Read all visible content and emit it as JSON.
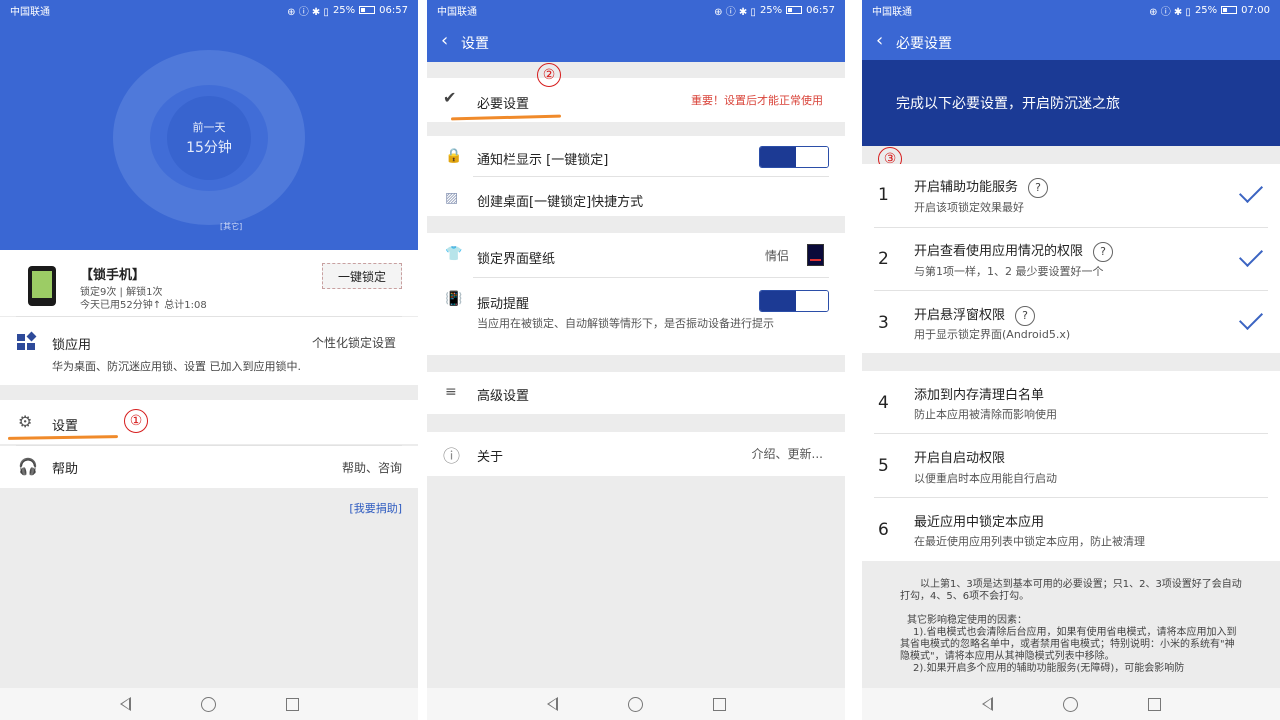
{
  "status1": {
    "carrier": "中国联通",
    "icons": "⊕ ⓘ ✱ ▯",
    "battery": "25%",
    "time": "06:57"
  },
  "status2": {
    "carrier": "中国联通",
    "icons": "⊕ ⓘ ✱ ▯",
    "battery": "25%",
    "time": "06:57"
  },
  "status3": {
    "carrier": "中国联通",
    "icons": "⊕ ⓘ ✱ ▯",
    "battery": "25%",
    "time": "07:00"
  },
  "screen1": {
    "gauge": {
      "label": "前一天",
      "value": "15分钟"
    },
    "other_tag": "[其它]",
    "lock_card": {
      "title": "【锁手机】",
      "stats1": "锁定9次 | 解锁1次",
      "stats2": "今天已用52分钟↑  总计1:08",
      "button": "一键锁定"
    },
    "lock_apps": {
      "title": "锁应用",
      "right": "个性化锁定设置",
      "subtitle": "华为桌面、防沉迷应用锁、设置 已加入到应用锁中."
    },
    "settings": {
      "title": "设置",
      "icon": "gear-icon"
    },
    "help": {
      "title": "帮助",
      "right": "帮助、咨询",
      "icon": "headset-icon"
    },
    "donate": "[我要捐助]",
    "marker": "①"
  },
  "screen2": {
    "appbar_title": "设置",
    "required": {
      "title": "必要设置",
      "warning": "重要！设置后才能正常使用"
    },
    "notify": {
      "title": "通知栏显示 [一键锁定]"
    },
    "shortcut": {
      "title": "创建桌面[一键锁定]快捷方式"
    },
    "wallpaper": {
      "title": "锁定界面壁纸",
      "value": "情侣"
    },
    "vibrate": {
      "title": "振动提醒",
      "subtitle": "当应用在被锁定、自动解锁等情形下，是否振动设备进行提示"
    },
    "advanced": {
      "title": "高级设置"
    },
    "about": {
      "title": "关于",
      "right": "介绍、更新..."
    },
    "marker": "②"
  },
  "screen3": {
    "appbar_title": "必要设置",
    "banner": "完成以下必要设置，开启防沉迷之旅",
    "marker": "③",
    "items": [
      {
        "num": "1",
        "title": "开启辅助功能服务",
        "subtitle": "开启该项锁定效果最好",
        "help": "?",
        "checked": true
      },
      {
        "num": "2",
        "title": "开启查看使用应用情况的权限",
        "subtitle": "与第1项一样，1、2 最少要设置好一个",
        "help": "?",
        "checked": true
      },
      {
        "num": "3",
        "title": "开启悬浮窗权限",
        "subtitle": "用于显示锁定界面(Android5.x)",
        "help": "?",
        "checked": true
      },
      {
        "num": "4",
        "title": "添加到内存清理白名单",
        "subtitle": "防止本应用被清除而影响使用",
        "checked": false
      },
      {
        "num": "5",
        "title": "开启自启动权限",
        "subtitle": "以便重启时本应用能自行启动",
        "checked": false
      },
      {
        "num": "6",
        "title": "最近应用中锁定本应用",
        "subtitle": "在最近使用应用列表中锁定本应用，防止被清理",
        "checked": false
      }
    ],
    "note": {
      "p1": "以上第1、3项是达到基本可用的必要设置；只1、2、3项设置好了会自动打勾，4、5、6项不会打勾。",
      "p2": "其它影响稳定使用的因素：",
      "p3": "1).省电模式也会清除后台应用，如果有使用省电模式，请将本应用加入到其省电模式的忽略名单中，或者禁用省电模式；特别说明：小米的系统有\"神隐模式\"，请将本应用从其神隐模式列表中移除。",
      "p4": "2).如果开启多个应用的辅助功能服务(无障碍)，可能会影响防"
    }
  },
  "colors": {
    "primary": "#3a67d3",
    "banner": "#1b3a95",
    "toggle": "#1c3a94",
    "warning": "#d9443a",
    "underline": "#f08a2a",
    "marker": "#d61d1d"
  }
}
